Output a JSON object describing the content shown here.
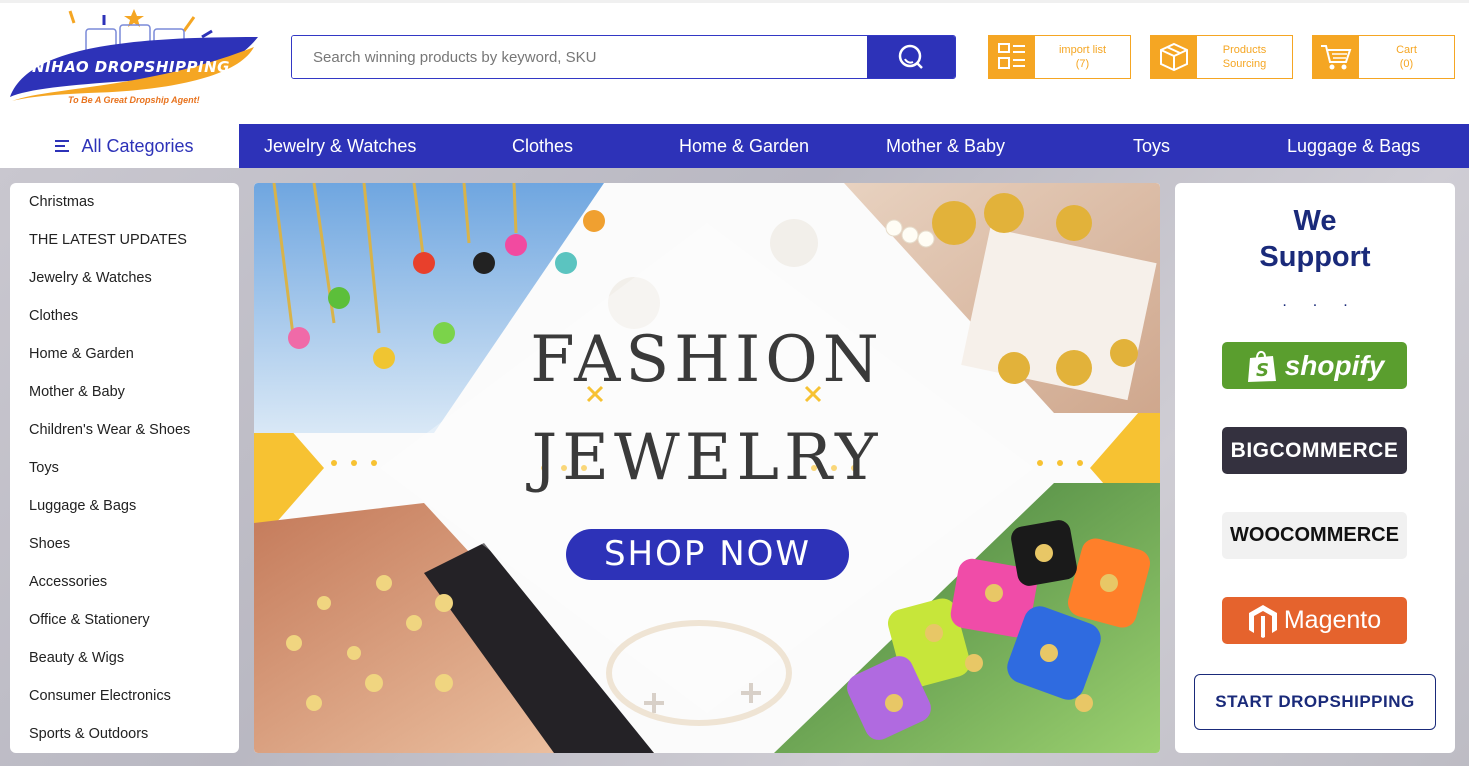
{
  "logo": {
    "name": "NIHAO DROPSHIPPING",
    "tagline": "To Be A Great Dropship Agent!"
  },
  "search": {
    "placeholder": "Search winning products by keyword, SKU",
    "button_icon": "search-icon"
  },
  "header_buttons": [
    {
      "line1": "import list",
      "line2": "(7)",
      "icon": "list-icon"
    },
    {
      "line1": "Products",
      "line2": "Sourcing",
      "icon": "box-icon"
    },
    {
      "line1": "Cart",
      "line2": "(0)",
      "icon": "cart-icon"
    }
  ],
  "nav": {
    "all_label": "All Categories",
    "items": [
      "Jewelry & Watches",
      "Clothes",
      "Home & Garden",
      "Mother & Baby",
      "Toys",
      "Luggage & Bags"
    ]
  },
  "sidebar": {
    "items": [
      "Christmas",
      "THE LATEST UPDATES",
      "Jewelry & Watches",
      "Clothes",
      "Home & Garden",
      "Mother & Baby",
      "Children's Wear & Shoes",
      "Toys",
      "Luggage & Bags",
      "Shoes",
      "Accessories",
      "Office & Stationery",
      "Beauty & Wigs",
      "Consumer Electronics",
      "Sports & Outdoors"
    ]
  },
  "banner": {
    "title_line1": "FASHION",
    "title_line2": "JEWELRY",
    "cta": "SHOP NOW"
  },
  "support": {
    "title_line1": "We",
    "title_line2": "Support",
    "dots": "...",
    "platforms": [
      "shopify",
      "BIGCOMMERCE",
      "WOOCOMMERCE",
      "Magento"
    ],
    "cta": "START DROPSHIPPING"
  },
  "colors": {
    "brand_blue": "#2d32b8",
    "accent_orange": "#f5a623",
    "navy": "#1a2a7a"
  }
}
